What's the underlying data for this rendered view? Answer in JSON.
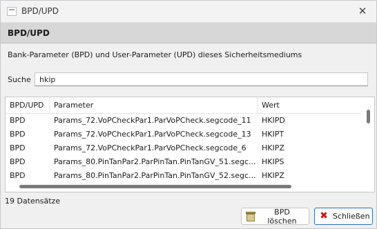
{
  "window": {
    "title": "BPD/UPD"
  },
  "header": {
    "title": "BPD/UPD"
  },
  "description": "Bank-Parameter (BPD) und User-Parameter (UPD) dieses Sicherheitsmediums",
  "search": {
    "label": "Suche",
    "value": "hkip"
  },
  "table": {
    "columns": [
      "BPD/UPD",
      "Parameter",
      "Wert"
    ],
    "rows": [
      [
        "BPD",
        "Params_72.VoPCheckPar1.ParVoPCheck.segcode_11",
        "HKIPD"
      ],
      [
        "BPD",
        "Params_72.VoPCheckPar1.ParVoPCheck.segcode_13",
        "HKIPT"
      ],
      [
        "BPD",
        "Params_72.VoPCheckPar1.ParVoPCheck.segcode_6",
        "HKIPZ"
      ],
      [
        "BPD",
        "Params_80.PinTanPar2.ParPinTan.PinTanGV_51.segc...",
        "HKIPS"
      ],
      [
        "BPD",
        "Params_80.PinTanPar2.ParPinTan.PinTanGV_52.segc...",
        "HKIPZ"
      ]
    ]
  },
  "status": {
    "count": "19 Datensätze"
  },
  "buttons": {
    "delete_label": "BPD löschen",
    "close_label": "Schließen"
  },
  "icons": {
    "delete": "trash-icon",
    "close": "red-x-icon"
  },
  "colors": {
    "header_band": "#d7d7d7",
    "accent_border": "#2a6fc9",
    "close_icon": "#d01818"
  }
}
